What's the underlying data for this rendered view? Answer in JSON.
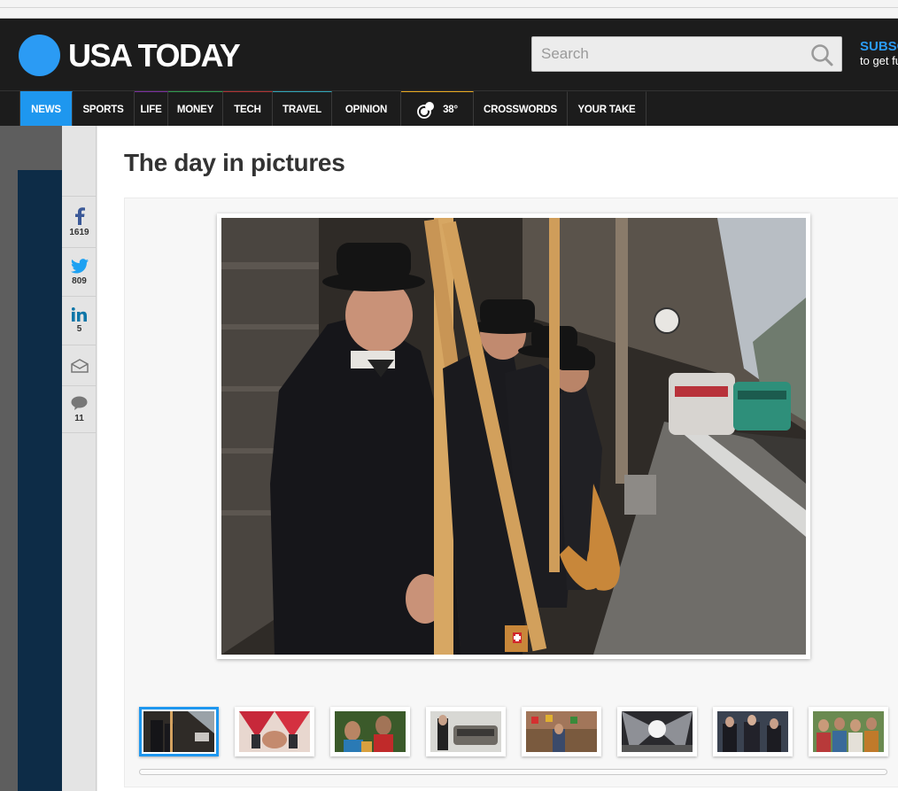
{
  "site": {
    "logo_text": "USA TODAY"
  },
  "search": {
    "placeholder": "Search"
  },
  "subscribe": {
    "line1": "SUBSCRIBE",
    "line2": "to get full access"
  },
  "nav": {
    "items": [
      {
        "label": "News",
        "accent": "#1e97ef"
      },
      {
        "label": "Sports",
        "accent": "#333333"
      },
      {
        "label": "Life",
        "accent": "#7a2ea0"
      },
      {
        "label": "Money",
        "accent": "#2e9a4d"
      },
      {
        "label": "Tech",
        "accent": "#b03232"
      },
      {
        "label": "Travel",
        "accent": "#2ea6b8"
      },
      {
        "label": "Opinion",
        "accent": "#3a3a3a"
      },
      {
        "label": "38°",
        "accent": "#e8a81e"
      },
      {
        "label": "Crosswords",
        "accent": "#3a3a3a"
      },
      {
        "label": "Your Take",
        "accent": "#3a3a3a"
      }
    ]
  },
  "share": {
    "facebook_count": "1619",
    "twitter_count": "809",
    "linkedin_count": "5",
    "comments_count": "11"
  },
  "page": {
    "title": "The day in pictures"
  },
  "gallery": {
    "thumbnail_count_visible": 8,
    "active_index": 0
  },
  "colors": {
    "brand": "#2b9bf4",
    "active_nav": "#1e97ef",
    "masthead": "#1c1c1c"
  }
}
